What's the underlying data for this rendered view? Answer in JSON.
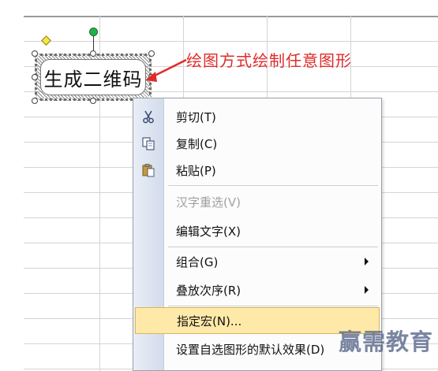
{
  "shape": {
    "text": "生成二维码"
  },
  "annotation": {
    "text": "绘图方式绘制任意图形",
    "color": "#e02a2a"
  },
  "context_menu": {
    "items": [
      {
        "label": "剪切(T)",
        "icon": "scissors-icon",
        "enabled": true,
        "submenu": false
      },
      {
        "label": "复制(C)",
        "icon": "copy-icon",
        "enabled": true,
        "submenu": false
      },
      {
        "label": "粘贴(P)",
        "icon": "paste-icon",
        "enabled": true,
        "submenu": false
      },
      {
        "label": "汉字重选(V)",
        "icon": "",
        "enabled": false,
        "submenu": false
      },
      {
        "label": "编辑文字(X)",
        "icon": "",
        "enabled": true,
        "submenu": false
      },
      {
        "label": "组合(G)",
        "icon": "",
        "enabled": true,
        "submenu": true
      },
      {
        "label": "叠放次序(R)",
        "icon": "",
        "enabled": true,
        "submenu": true
      },
      {
        "label": "指定宏(N)...",
        "icon": "",
        "enabled": true,
        "submenu": false,
        "highlighted": true
      },
      {
        "label": "设置自选图形的默认效果(D)",
        "icon": "",
        "enabled": true,
        "submenu": false
      }
    ]
  },
  "watermark": {
    "text": "赢需教育"
  }
}
